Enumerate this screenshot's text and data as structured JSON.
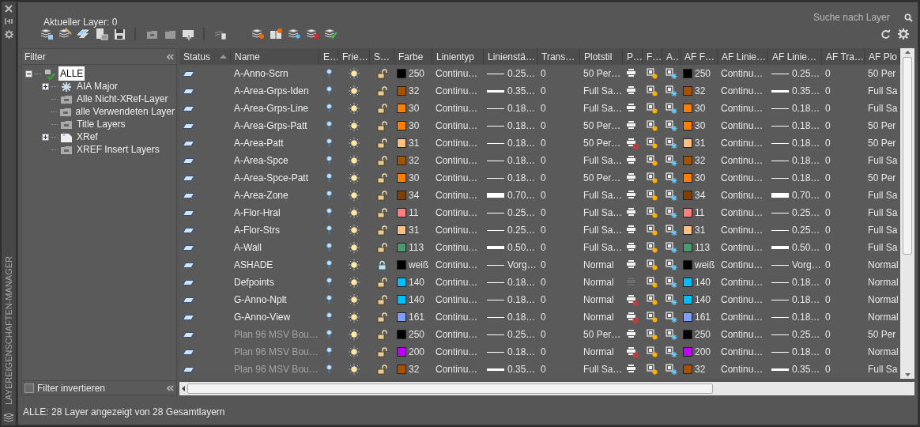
{
  "side_strip": {
    "title": "LAYEREIGENSCHAFTEN-MANAGER"
  },
  "current_layer": "Aktueller Layer: 0",
  "search": {
    "placeholder": "Suche nach Layer"
  },
  "filter_panel": {
    "title": "Filter",
    "tree": [
      {
        "label": "ALLE",
        "kind": "all",
        "selected": true,
        "collapsed": false,
        "children": [
          {
            "label": "AIA Major",
            "kind": "group",
            "selected": false,
            "collapsed": true
          },
          {
            "label": "Alle Nicht-XRef-Layer",
            "kind": "filter",
            "selected": false,
            "collapsed": false
          },
          {
            "label": "alle Verwendeten Layer",
            "kind": "filter",
            "selected": false,
            "collapsed": false
          },
          {
            "label": "Title Layers",
            "kind": "filter",
            "selected": false,
            "collapsed": false
          },
          {
            "label": "XRef",
            "kind": "xref",
            "selected": false,
            "collapsed": true
          },
          {
            "label": "XREF Insert Layers",
            "kind": "filter",
            "selected": false,
            "collapsed": false
          }
        ]
      }
    ],
    "invert": {
      "label": "Filter invertieren",
      "checked": false
    }
  },
  "table": {
    "columns": [
      {
        "label": "Status",
        "sorted": true
      },
      {
        "label": "Name",
        "sorted": false
      },
      {
        "label": "E…",
        "sorted": false
      },
      {
        "label": "Frie…",
        "sorted": false
      },
      {
        "label": "S…",
        "sorted": false
      },
      {
        "label": "Farbe",
        "sorted": false
      },
      {
        "label": "Linientyp",
        "sorted": false
      },
      {
        "label": "Linienstä…",
        "sorted": false
      },
      {
        "label": "Trans…",
        "sorted": false
      },
      {
        "label": "Plotstil",
        "sorted": false
      },
      {
        "label": "P…",
        "sorted": false
      },
      {
        "label": "F…",
        "sorted": false
      },
      {
        "label": "A…",
        "sorted": false
      },
      {
        "label": "AF F…",
        "sorted": false
      },
      {
        "label": "AF Linie…",
        "sorted": false
      },
      {
        "label": "AF Linie…",
        "sorted": false
      },
      {
        "label": "AF Tra…",
        "sorted": false
      },
      {
        "label": "AF Plo",
        "sorted": false
      }
    ],
    "rows": [
      {
        "name": "A-Anno-Scrn",
        "dimmed": false,
        "on": true,
        "frozen": false,
        "locked": false,
        "plot": true,
        "plot_disabled": false,
        "main": {
          "color": "#000000",
          "color_label": "250",
          "linetype": "Continu…",
          "lineweight": {
            "kind": "thin",
            "text": "0.25…"
          },
          "transparency": "0",
          "plotstyle": "50 Per…"
        },
        "af": {
          "color": "#000000",
          "color_label": "250",
          "linetype": "Continu…",
          "lineweight": {
            "kind": "thin",
            "text": "0.25…"
          },
          "transparency": "0",
          "plotstyle": "50 Per"
        }
      },
      {
        "name": "A-Area-Grps-Iden",
        "dimmed": false,
        "on": true,
        "frozen": false,
        "locked": false,
        "plot": true,
        "plot_disabled": false,
        "main": {
          "color": "#a35200",
          "color_label": "32",
          "linetype": "Continu…",
          "lineweight": {
            "kind": "medium",
            "text": "0.35…"
          },
          "transparency": "0",
          "plotstyle": "Full Sa…"
        },
        "af": {
          "color": "#a35200",
          "color_label": "32",
          "linetype": "Continu…",
          "lineweight": {
            "kind": "medium",
            "text": "0.35…"
          },
          "transparency": "0",
          "plotstyle": "Full Sa"
        }
      },
      {
        "name": "A-Area-Grps-Line",
        "dimmed": false,
        "on": true,
        "frozen": false,
        "locked": false,
        "plot": true,
        "plot_disabled": false,
        "main": {
          "color": "#ff7f00",
          "color_label": "30",
          "linetype": "Continu…",
          "lineweight": {
            "kind": "thin",
            "text": "0.18…"
          },
          "transparency": "0",
          "plotstyle": "Full Sa…"
        },
        "af": {
          "color": "#ff7f00",
          "color_label": "30",
          "linetype": "Continu…",
          "lineweight": {
            "kind": "thin",
            "text": "0.18…"
          },
          "transparency": "0",
          "plotstyle": "Full Sa"
        }
      },
      {
        "name": "A-Area-Grps-Patt",
        "dimmed": false,
        "on": true,
        "frozen": false,
        "locked": false,
        "plot": true,
        "plot_disabled": false,
        "main": {
          "color": "#ff7f00",
          "color_label": "30",
          "linetype": "Continu…",
          "lineweight": {
            "kind": "thin",
            "text": "0.18…"
          },
          "transparency": "0",
          "plotstyle": "50 Per…"
        },
        "af": {
          "color": "#ff7f00",
          "color_label": "30",
          "linetype": "Continu…",
          "lineweight": {
            "kind": "thin",
            "text": "0.18…"
          },
          "transparency": "0",
          "plotstyle": "50 Per"
        }
      },
      {
        "name": "A-Area-Patt",
        "dimmed": false,
        "on": true,
        "frozen": false,
        "locked": false,
        "plot": false,
        "plot_disabled": false,
        "main": {
          "color": "#ffbf7f",
          "color_label": "31",
          "linetype": "Continu…",
          "lineweight": {
            "kind": "thin",
            "text": "0.18…"
          },
          "transparency": "0",
          "plotstyle": "50 Per…"
        },
        "af": {
          "color": "#ffbf7f",
          "color_label": "31",
          "linetype": "Continu…",
          "lineweight": {
            "kind": "thin",
            "text": "0.18…"
          },
          "transparency": "0",
          "plotstyle": "50 Per"
        }
      },
      {
        "name": "A-Area-Spce",
        "dimmed": false,
        "on": true,
        "frozen": false,
        "locked": false,
        "plot": true,
        "plot_disabled": false,
        "main": {
          "color": "#a35200",
          "color_label": "32",
          "linetype": "Continu…",
          "lineweight": {
            "kind": "thin",
            "text": "0.18…"
          },
          "transparency": "0",
          "plotstyle": "Full Sa…"
        },
        "af": {
          "color": "#a35200",
          "color_label": "32",
          "linetype": "Continu…",
          "lineweight": {
            "kind": "thin",
            "text": "0.18…"
          },
          "transparency": "0",
          "plotstyle": "Full Sa"
        }
      },
      {
        "name": "A-Area-Spce-Patt",
        "dimmed": false,
        "on": true,
        "frozen": false,
        "locked": false,
        "plot": true,
        "plot_disabled": false,
        "main": {
          "color": "#ff7f00",
          "color_label": "30",
          "linetype": "Continu…",
          "lineweight": {
            "kind": "thin",
            "text": "0.18…"
          },
          "transparency": "0",
          "plotstyle": "50 Per…"
        },
        "af": {
          "color": "#ff7f00",
          "color_label": "30",
          "linetype": "Continu…",
          "lineweight": {
            "kind": "thin",
            "text": "0.18…"
          },
          "transparency": "0",
          "plotstyle": "50 Per"
        }
      },
      {
        "name": "A-Area-Zone",
        "dimmed": false,
        "on": true,
        "frozen": false,
        "locked": false,
        "plot": true,
        "plot_disabled": false,
        "main": {
          "color": "#7f3f00",
          "color_label": "34",
          "linetype": "Continu…",
          "lineweight": {
            "kind": "heavy",
            "text": "0.70…"
          },
          "transparency": "0",
          "plotstyle": "Full Sa…"
        },
        "af": {
          "color": "#7f3f00",
          "color_label": "34",
          "linetype": "Continu…",
          "lineweight": {
            "kind": "heavy",
            "text": "0.70…"
          },
          "transparency": "0",
          "plotstyle": "Full Sa"
        }
      },
      {
        "name": "A-Flor-Hral",
        "dimmed": false,
        "on": true,
        "frozen": false,
        "locked": false,
        "plot": true,
        "plot_disabled": false,
        "main": {
          "color": "#ff7f7f",
          "color_label": "11",
          "linetype": "Continu…",
          "lineweight": {
            "kind": "thin",
            "text": "0.25…"
          },
          "transparency": "0",
          "plotstyle": "Full Sa…"
        },
        "af": {
          "color": "#ff7f7f",
          "color_label": "11",
          "linetype": "Continu…",
          "lineweight": {
            "kind": "thin",
            "text": "0.25…"
          },
          "transparency": "0",
          "plotstyle": "Full Sa"
        }
      },
      {
        "name": "A-Flor-Strs",
        "dimmed": false,
        "on": true,
        "frozen": false,
        "locked": false,
        "plot": true,
        "plot_disabled": false,
        "main": {
          "color": "#ffbf7f",
          "color_label": "31",
          "linetype": "Continu…",
          "lineweight": {
            "kind": "thin",
            "text": "0.25…"
          },
          "transparency": "0",
          "plotstyle": "Full Sa…"
        },
        "af": {
          "color": "#ffbf7f",
          "color_label": "31",
          "linetype": "Continu…",
          "lineweight": {
            "kind": "thin",
            "text": "0.25…"
          },
          "transparency": "0",
          "plotstyle": "Full Sa"
        }
      },
      {
        "name": "A-Wall",
        "dimmed": false,
        "on": true,
        "frozen": false,
        "locked": false,
        "plot": true,
        "plot_disabled": false,
        "main": {
          "color": "#4c9970",
          "color_label": "113",
          "linetype": "Continu…",
          "lineweight": {
            "kind": "bold",
            "text": "0.50…"
          },
          "transparency": "0",
          "plotstyle": "Full Sa…"
        },
        "af": {
          "color": "#4c9970",
          "color_label": "113",
          "linetype": "Continu…",
          "lineweight": {
            "kind": "bold",
            "text": "0.50…"
          },
          "transparency": "0",
          "plotstyle": "Full Sa"
        }
      },
      {
        "name": "ASHADE",
        "dimmed": false,
        "on": true,
        "frozen": false,
        "locked": true,
        "plot": true,
        "plot_disabled": false,
        "main": {
          "color": "#000000",
          "color_label": "weiß",
          "linetype": "Continu…",
          "lineweight": {
            "kind": "thin",
            "text": "Vorg…"
          },
          "transparency": "0",
          "plotstyle": "Normal"
        },
        "af": {
          "color": "#000000",
          "color_label": "weiß",
          "linetype": "Continu…",
          "lineweight": {
            "kind": "thin",
            "text": "Vorg…"
          },
          "transparency": "0",
          "plotstyle": "Normal"
        }
      },
      {
        "name": "Defpoints",
        "dimmed": false,
        "on": true,
        "frozen": false,
        "locked": false,
        "plot": true,
        "plot_disabled": true,
        "main": {
          "color": "#00bfff",
          "color_label": "140",
          "linetype": "Continu…",
          "lineweight": {
            "kind": "thin",
            "text": "0.18…"
          },
          "transparency": "0",
          "plotstyle": "Normal"
        },
        "af": {
          "color": "#00bfff",
          "color_label": "140",
          "linetype": "Continu…",
          "lineweight": {
            "kind": "thin",
            "text": "0.18…"
          },
          "transparency": "0",
          "plotstyle": "Normal"
        }
      },
      {
        "name": "G-Anno-Nplt",
        "dimmed": false,
        "on": true,
        "frozen": false,
        "locked": false,
        "plot": false,
        "plot_disabled": false,
        "main": {
          "color": "#00bfff",
          "color_label": "140",
          "linetype": "Continu…",
          "lineweight": {
            "kind": "thin",
            "text": "0.18…"
          },
          "transparency": "0",
          "plotstyle": "Normal"
        },
        "af": {
          "color": "#00bfff",
          "color_label": "140",
          "linetype": "Continu…",
          "lineweight": {
            "kind": "thin",
            "text": "0.18…"
          },
          "transparency": "0",
          "plotstyle": "Normal"
        }
      },
      {
        "name": "G-Anno-View",
        "dimmed": false,
        "on": true,
        "frozen": false,
        "locked": false,
        "plot": false,
        "plot_disabled": false,
        "main": {
          "color": "#7f9fff",
          "color_label": "161",
          "linetype": "Continu…",
          "lineweight": {
            "kind": "thin",
            "text": "0.18…"
          },
          "transparency": "0",
          "plotstyle": "Normal"
        },
        "af": {
          "color": "#7f9fff",
          "color_label": "161",
          "linetype": "Continu…",
          "lineweight": {
            "kind": "thin",
            "text": "0.18…"
          },
          "transparency": "0",
          "plotstyle": "Normal"
        }
      },
      {
        "name": "Plan 96 MSV Bou…",
        "dimmed": true,
        "on": true,
        "frozen": false,
        "locked": false,
        "plot": true,
        "plot_disabled": false,
        "main": {
          "color": "#000000",
          "color_label": "250",
          "linetype": "Continu…",
          "lineweight": {
            "kind": "thin",
            "text": "0.25…"
          },
          "transparency": "0",
          "plotstyle": "50 Per…"
        },
        "af": {
          "color": "#000000",
          "color_label": "250",
          "linetype": "Continu…",
          "lineweight": {
            "kind": "thin",
            "text": "0.25…"
          },
          "transparency": "0",
          "plotstyle": "50 Per"
        }
      },
      {
        "name": "Plan 96 MSV Bou…",
        "dimmed": true,
        "on": true,
        "frozen": false,
        "locked": false,
        "plot": false,
        "plot_disabled": false,
        "main": {
          "color": "#bf00ff",
          "color_label": "200",
          "linetype": "Continu…",
          "lineweight": {
            "kind": "thin",
            "text": "0.18…"
          },
          "transparency": "0",
          "plotstyle": "Normal"
        },
        "af": {
          "color": "#bf00ff",
          "color_label": "200",
          "linetype": "Continu…",
          "lineweight": {
            "kind": "thin",
            "text": "0.18…"
          },
          "transparency": "0",
          "plotstyle": "Normal"
        }
      },
      {
        "name": "Plan 96 MSV Bou…",
        "dimmed": true,
        "on": true,
        "frozen": false,
        "locked": false,
        "plot": true,
        "plot_disabled": false,
        "main": {
          "color": "#a35200",
          "color_label": "32",
          "linetype": "Continu…",
          "lineweight": {
            "kind": "medium",
            "text": "0.35…"
          },
          "transparency": "0",
          "plotstyle": "Full Sa…"
        },
        "af": {
          "color": "#a35200",
          "color_label": "32",
          "linetype": "Continu…",
          "lineweight": {
            "kind": "medium",
            "text": "0.35…"
          },
          "transparency": "0",
          "plotstyle": "Full Sa"
        }
      }
    ]
  },
  "status_bar": "ALLE: 28 Layer angezeigt von 28 Gesamtlayern"
}
